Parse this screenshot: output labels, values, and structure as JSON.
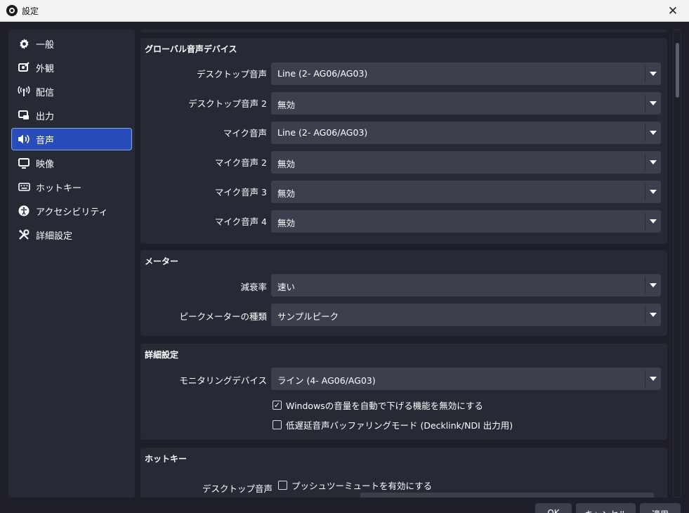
{
  "window": {
    "title": "設定"
  },
  "sidebar": {
    "items": [
      {
        "label": "一般",
        "icon": "gear-icon"
      },
      {
        "label": "外観",
        "icon": "appearance-icon"
      },
      {
        "label": "配信",
        "icon": "broadcast-icon"
      },
      {
        "label": "出力",
        "icon": "output-icon"
      },
      {
        "label": "音声",
        "icon": "speaker-icon",
        "active": true
      },
      {
        "label": "映像",
        "icon": "monitor-icon"
      },
      {
        "label": "ホットキー",
        "icon": "keyboard-icon"
      },
      {
        "label": "アクセシビリティ",
        "icon": "accessibility-icon"
      },
      {
        "label": "詳細設定",
        "icon": "tools-icon"
      }
    ]
  },
  "global_audio": {
    "title": "グローバル音声デバイス",
    "rows": [
      {
        "label": "デスクトップ音声",
        "value": "Line (2- AG06/AG03)"
      },
      {
        "label": "デスクトップ音声 2",
        "value": "無効"
      },
      {
        "label": "マイク音声",
        "value": "Line (2- AG06/AG03)"
      },
      {
        "label": "マイク音声 2",
        "value": "無効"
      },
      {
        "label": "マイク音声 3",
        "value": "無効"
      },
      {
        "label": "マイク音声 4",
        "value": "無効"
      }
    ]
  },
  "meter": {
    "title": "メーター",
    "rows": [
      {
        "label": "減衰率",
        "value": "速い"
      },
      {
        "label": "ピークメーターの種類",
        "value": "サンプルピーク"
      }
    ]
  },
  "advanced": {
    "title": "詳細設定",
    "monitoring_label": "モニタリングデバイス",
    "monitoring_value": "ライン (4- AG06/AG03)",
    "checkbox1": {
      "label": "Windowsの音量を自動で下げる機能を無効にする",
      "checked": true,
      "mark": "✓"
    },
    "checkbox2": {
      "label": "低遅延音声バッファリングモード (Decklink/NDI 出力用)",
      "checked": false
    }
  },
  "hotkeys": {
    "title": "ホットキー",
    "desktop_label": "デスクトップ音声",
    "push_to_mute": "プッシュツーミュートを有効にする"
  },
  "buttons": {
    "ok": "OK",
    "cancel": "キャンセル",
    "apply": "適用"
  },
  "colors": {
    "accent": "#284cb8",
    "panel": "#272935",
    "background": "#1e1f29",
    "field": "#3c404d"
  }
}
